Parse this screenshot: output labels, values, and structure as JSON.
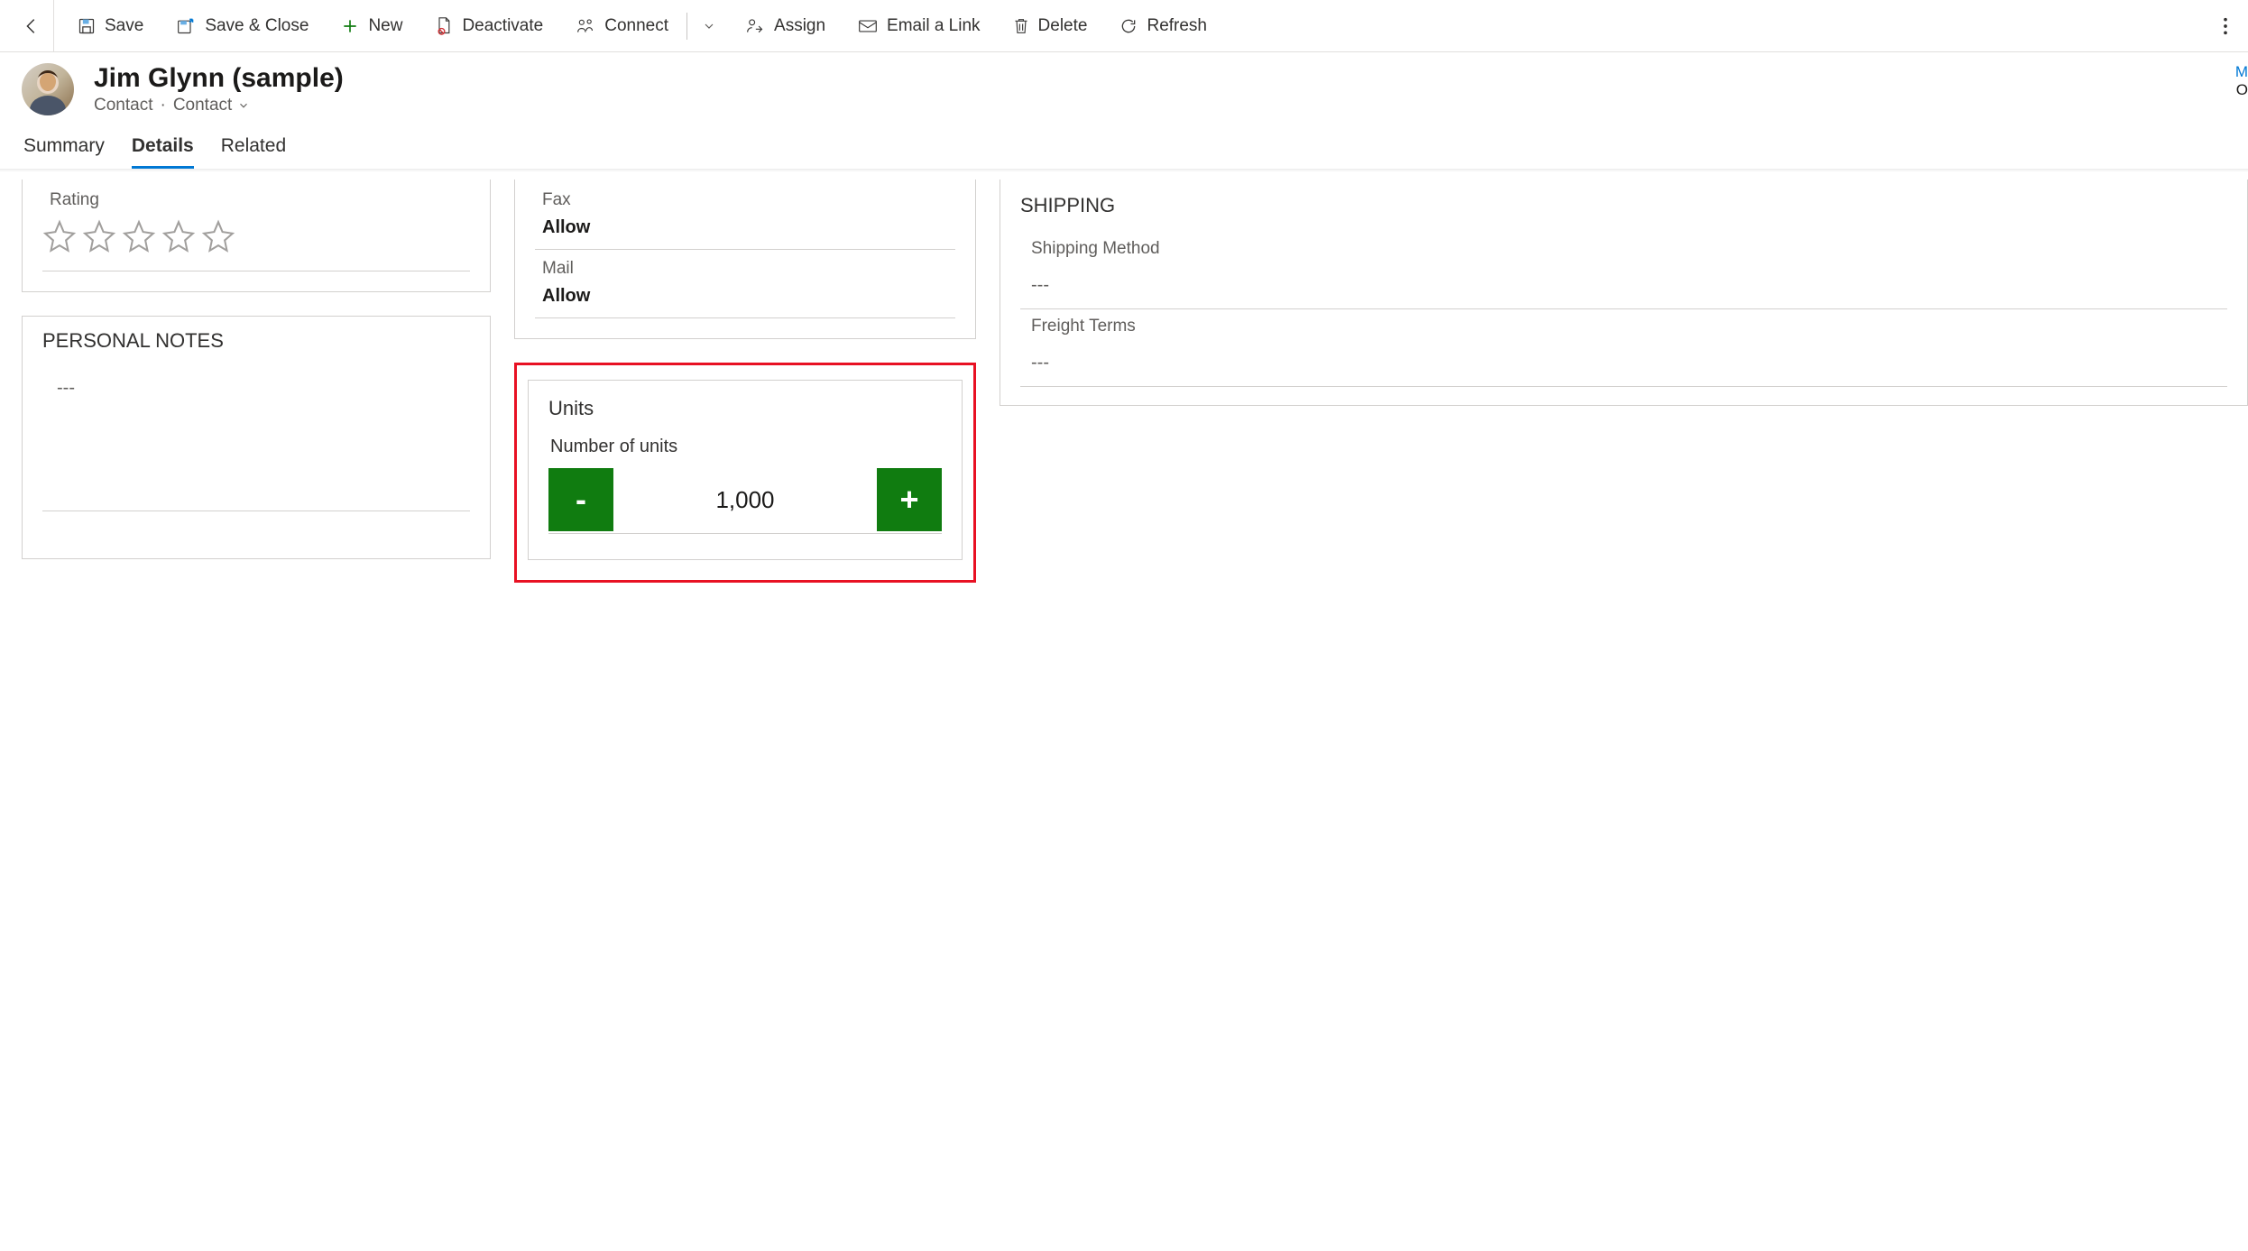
{
  "toolbar": {
    "save": "Save",
    "save_close": "Save & Close",
    "new": "New",
    "deactivate": "Deactivate",
    "connect": "Connect",
    "assign": "Assign",
    "email_link": "Email a Link",
    "delete": "Delete",
    "refresh": "Refresh"
  },
  "header": {
    "title": "Jim Glynn (sample)",
    "entity": "Contact",
    "form": "Contact",
    "right_clip_line1": "M",
    "right_clip_line2": "O"
  },
  "tabs": {
    "summary": "Summary",
    "details": "Details",
    "related": "Related"
  },
  "left": {
    "rating_label": "Rating",
    "personal_notes_title": "PERSONAL NOTES",
    "personal_notes_value": "---"
  },
  "mid": {
    "fax_label": "Fax",
    "fax_value": "Allow",
    "mail_label": "Mail",
    "mail_value": "Allow",
    "units_section": "Units",
    "units_label": "Number of units",
    "units_value": "1,000",
    "minus": "-",
    "plus": "+"
  },
  "right": {
    "shipping_title": "SHIPPING",
    "method_label": "Shipping Method",
    "method_value": "---",
    "freight_label": "Freight Terms",
    "freight_value": "---"
  }
}
